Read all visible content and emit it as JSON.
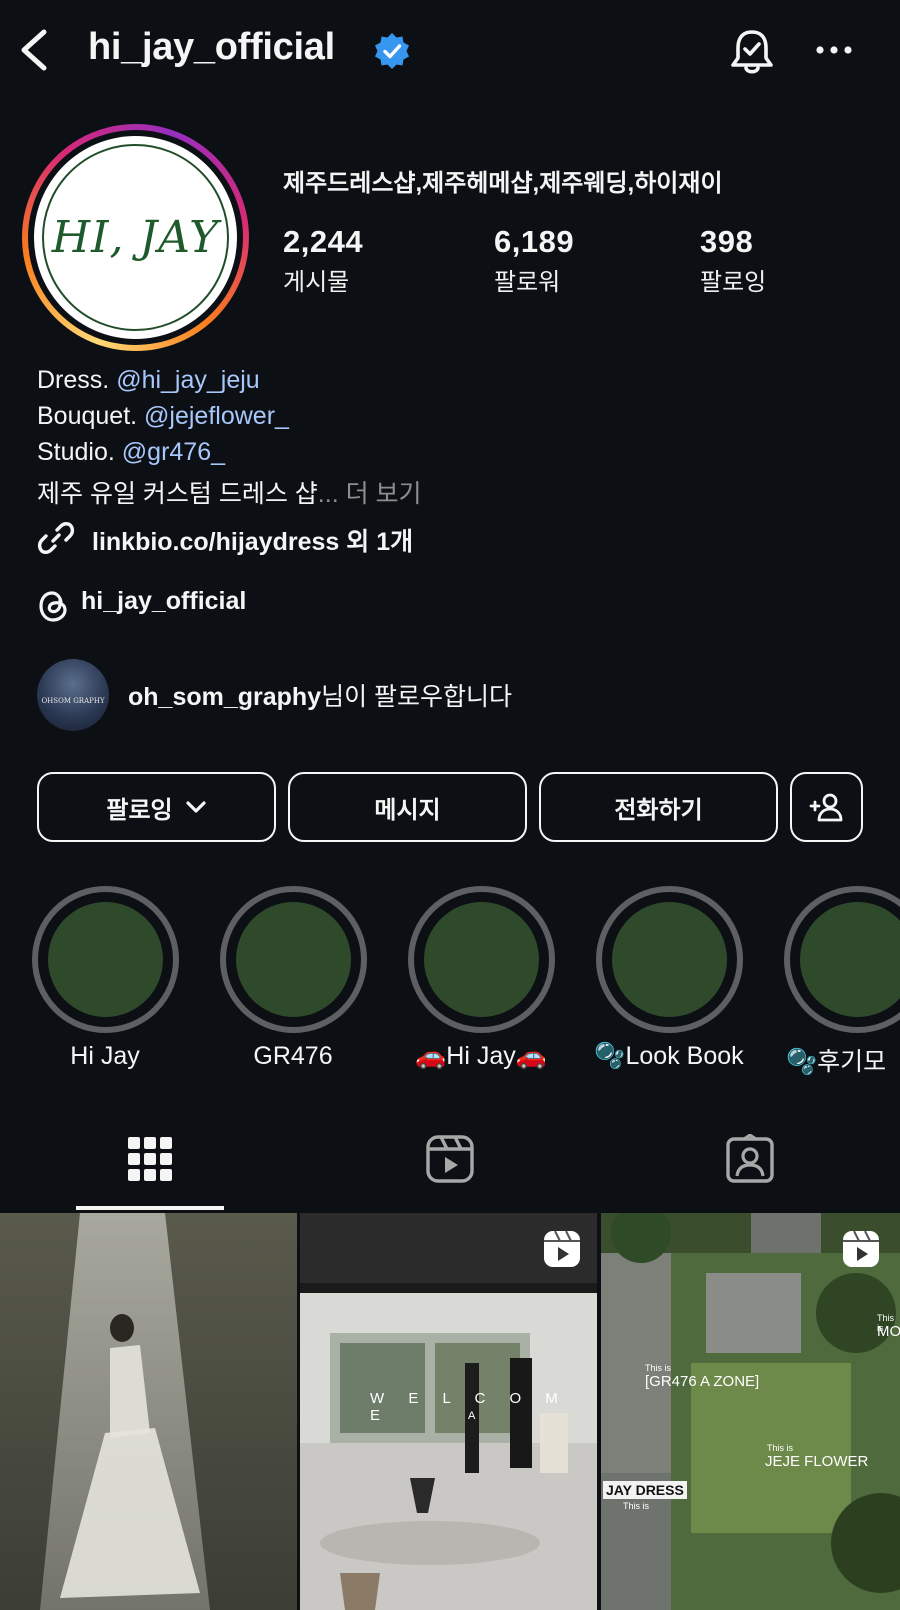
{
  "header": {
    "username": "hi_jay_official",
    "icons": [
      "back-icon",
      "verified-icon",
      "bell-icon",
      "more-icon"
    ]
  },
  "avatar": {
    "logo_text": "HI, JAY"
  },
  "profile": {
    "category": "제주드레스샵,제주헤메샵,제주웨딩,하이재이",
    "stats": [
      {
        "value": "2,244",
        "label": "게시물"
      },
      {
        "value": "6,189",
        "label": "팔로워"
      },
      {
        "value": "398",
        "label": "팔로잉"
      }
    ]
  },
  "bio": {
    "lines": [
      {
        "prefix": "Dress. ",
        "mention": "@hi_jay_jeju"
      },
      {
        "prefix": "Bouquet. ",
        "mention": "@jejeflower_"
      }
    ],
    "studio_prefix": "Studio. ",
    "studio_mention": "@gr476_",
    "description": "제주 유일 커스텀 드레스 샵",
    "ellipsis": "...",
    "more": " 더 보기",
    "link": "linkbio.co/hijaydress 외 1개",
    "threads": "hi_jay_official"
  },
  "followed_by": {
    "avatar_text": "OHSOM GRAPHY",
    "username": "oh_som_graphy",
    "suffix": "님이 팔로우합니다"
  },
  "buttons": {
    "following": "팔로잉",
    "message": "메시지",
    "call": "전화하기"
  },
  "highlights": [
    {
      "label": "Hi Jay"
    },
    {
      "label": "GR476"
    },
    {
      "label": "🚗Hi Jay🚗"
    },
    {
      "label": "🫧Look Book"
    },
    {
      "label": "🫧후기모"
    }
  ],
  "tabs": [
    "grid-icon",
    "reels-icon",
    "tagged-icon"
  ],
  "posts": [
    {
      "type": "photo"
    },
    {
      "type": "reel",
      "overlay_text": "W E L C O M E",
      "overlay_sub": "A"
    },
    {
      "type": "reel",
      "labels": [
        "[GR476 A ZONE]",
        "JEJE FLOWER",
        "JAY DRESS",
        "MO"
      ],
      "small": [
        "This is",
        "This is",
        "This is",
        "This is"
      ]
    }
  ],
  "colors": {
    "background": "#0c1014",
    "mention": "#a8c7fa",
    "verified": "#3797f0",
    "highlight_fill": "#2e4a2b"
  }
}
